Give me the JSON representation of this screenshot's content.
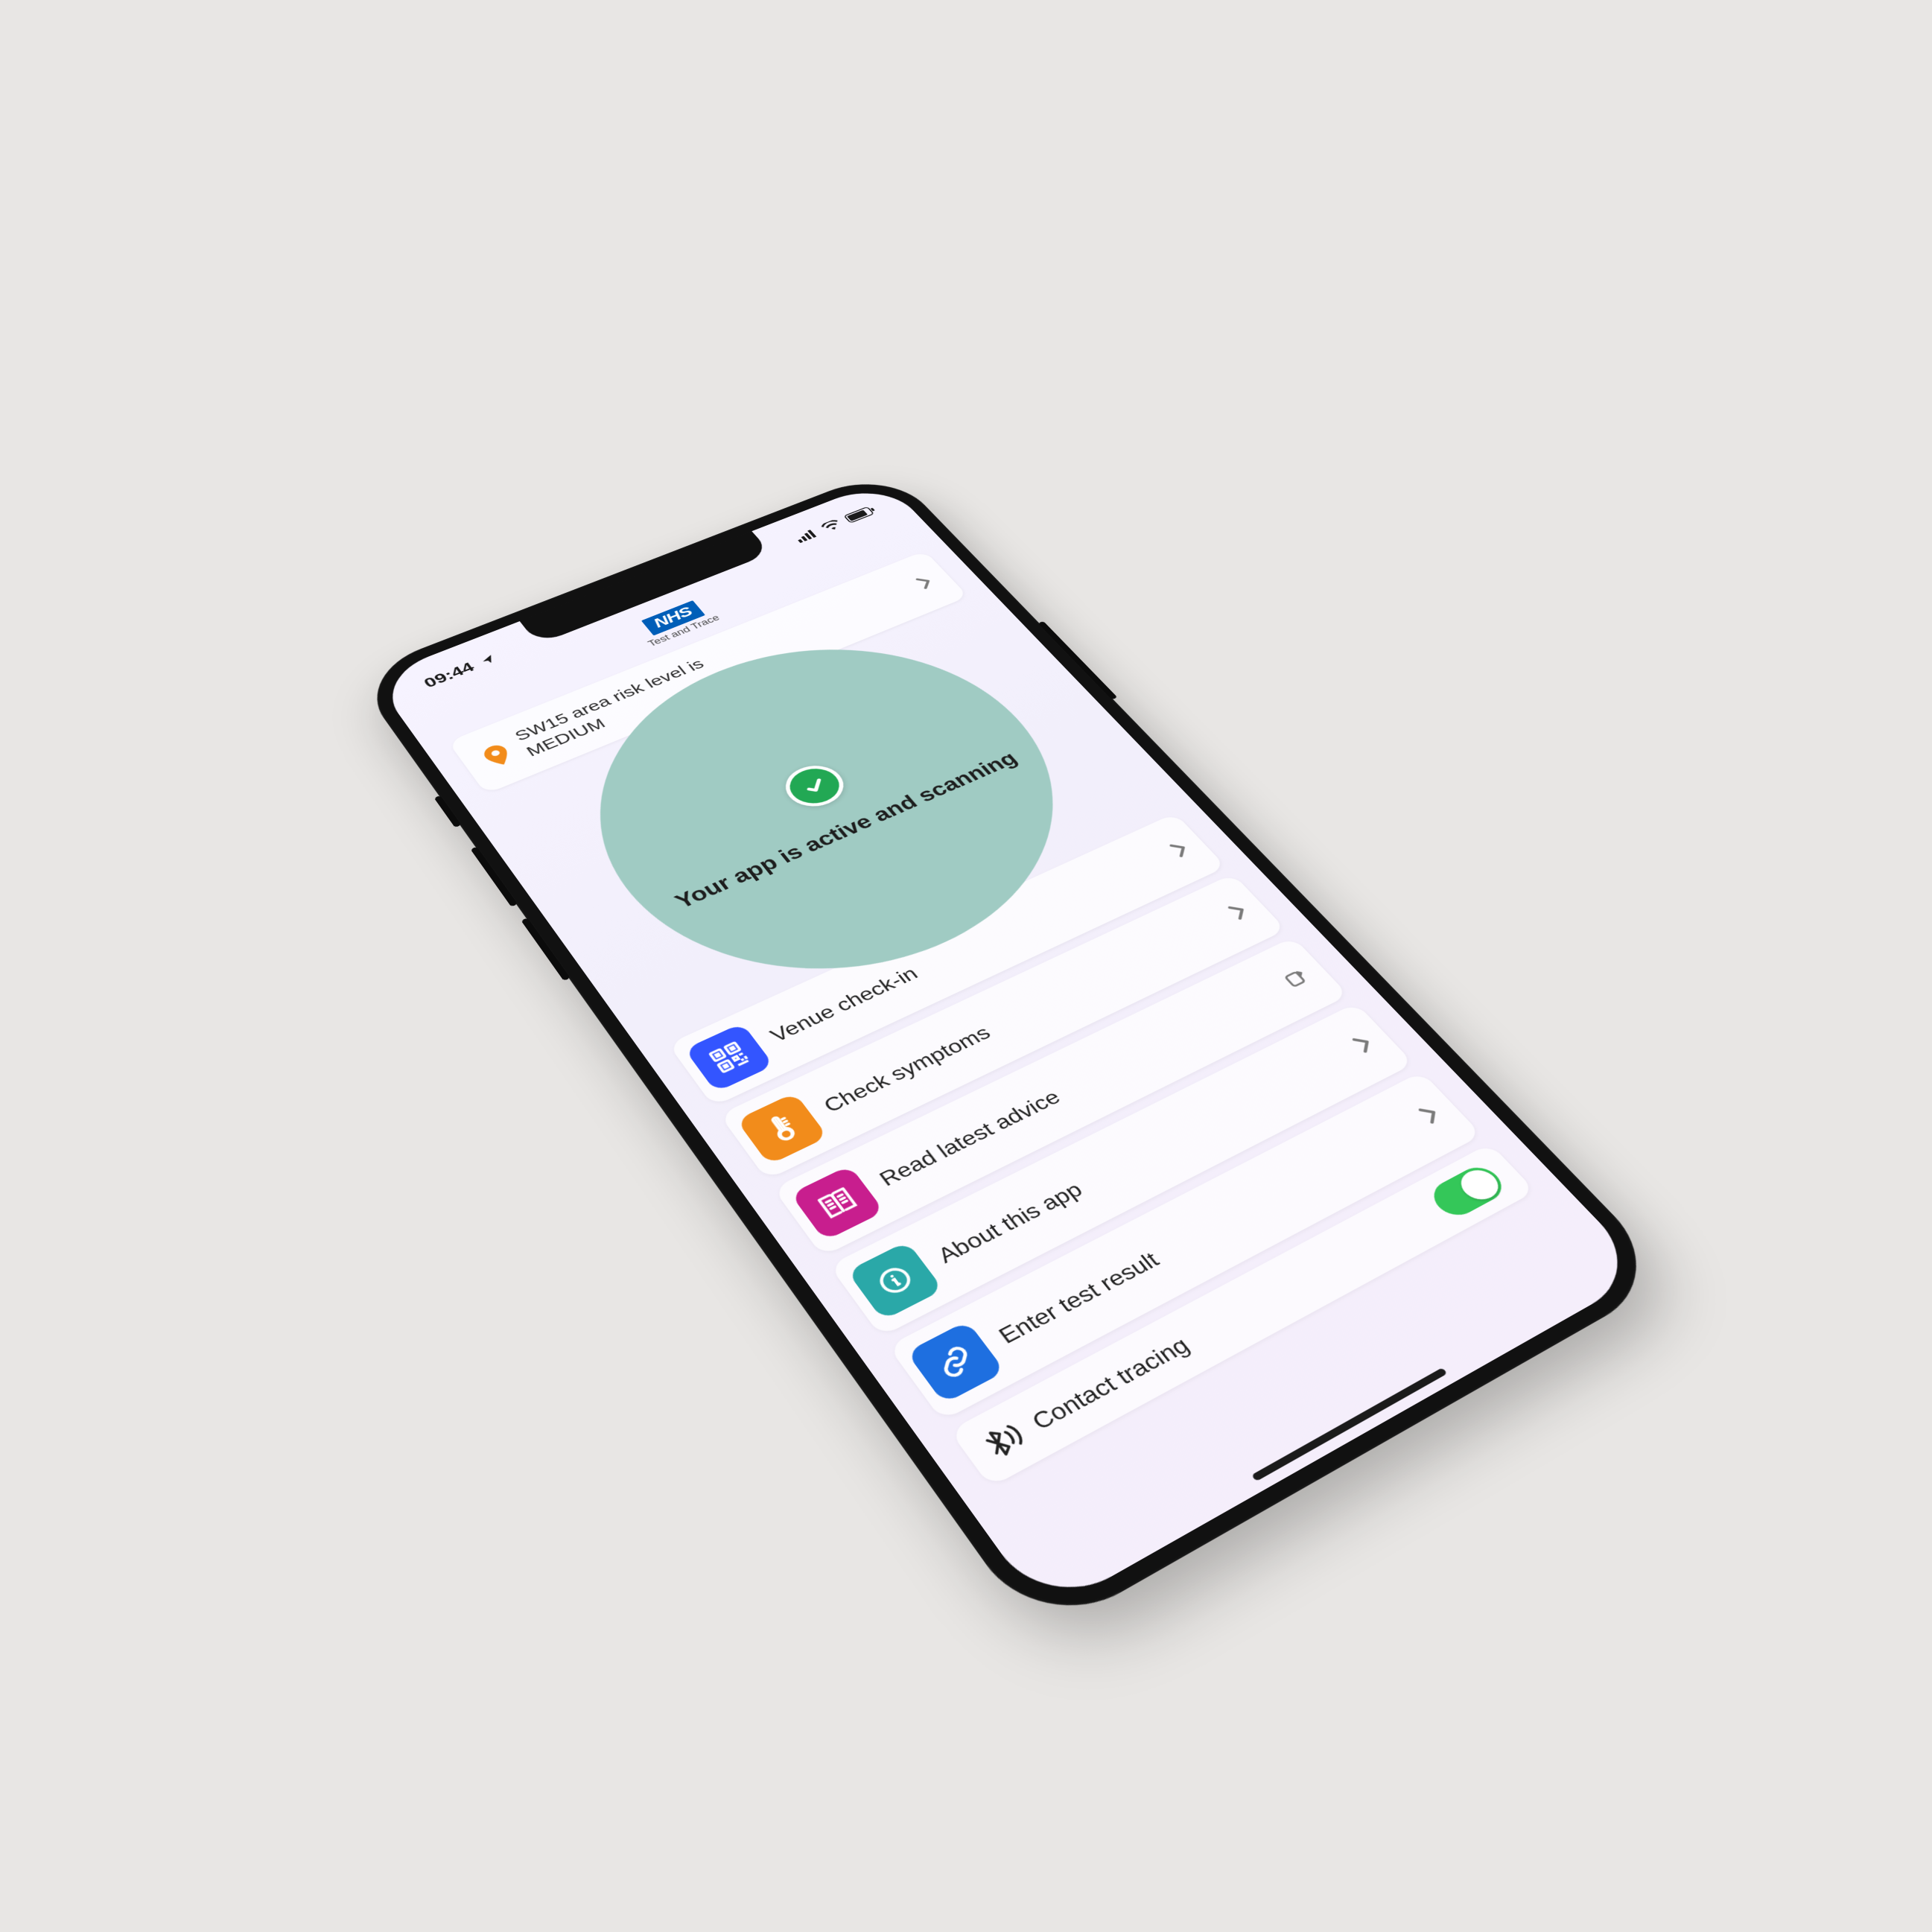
{
  "statusbar": {
    "time": "09:44"
  },
  "header": {
    "logo": "NHS",
    "sub": "Test and Trace"
  },
  "risk": {
    "line1": "SW15 area risk level is",
    "line2": "MEDIUM"
  },
  "hero": {
    "status": "Your app is active and scanning"
  },
  "menu": {
    "items": [
      {
        "label": "Venue check-in",
        "trail": "chevron"
      },
      {
        "label": "Check symptoms",
        "trail": "chevron"
      },
      {
        "label": "Read latest advice",
        "trail": "external"
      },
      {
        "label": "About this app",
        "trail": "chevron"
      },
      {
        "label": "Enter test result",
        "trail": "chevron"
      }
    ]
  },
  "tracing": {
    "label": "Contact tracing",
    "enabled": true
  }
}
